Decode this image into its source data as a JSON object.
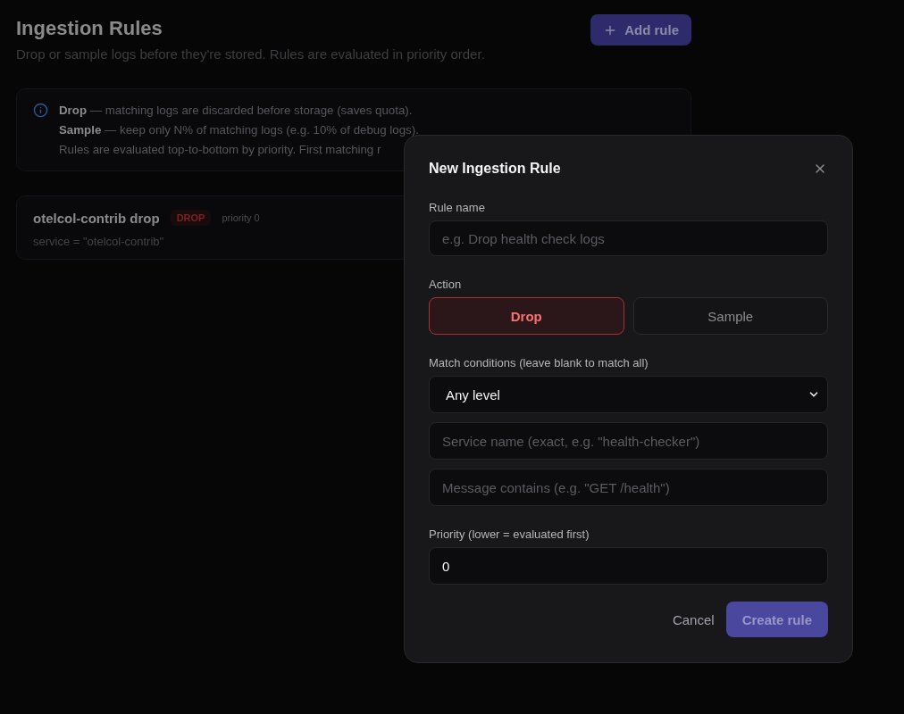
{
  "page": {
    "title": "Ingestion Rules",
    "subtitle": "Drop or sample logs before they're stored. Rules are evaluated in priority order.",
    "add_button": "Add rule"
  },
  "info_box": {
    "lines": [
      "**Drop** — matching logs are discarded before storage (saves quota).",
      "**Sample** — keep only N% of matching logs (e.g. 10% of debug logs).",
      "Rules are evaluated top-to-bottom by priority. First matching r"
    ]
  },
  "rules": [
    {
      "name": "otelcol-contrib drop",
      "action": "DROP",
      "priority": "priority 0",
      "condition": "service = \"otelcol-contrib\""
    }
  ],
  "dialog": {
    "title": "New Ingestion Rule",
    "rule_name": {
      "label": "Rule name",
      "placeholder": "e.g. Drop health check logs"
    },
    "action": {
      "label": "Action",
      "options": [
        {
          "label": "Drop",
          "selected": true
        },
        {
          "label": "Sample",
          "selected": false
        }
      ]
    },
    "match": {
      "label": "Match conditions (leave blank to match all)",
      "level_select": {
        "value": "Any level"
      },
      "service_field": {
        "placeholder": "Service name (exact, e.g. \"health-checker\")"
      },
      "message_field": {
        "placeholder": "Message contains (e.g. \"GET /health\")"
      }
    },
    "priority": {
      "label": "Priority (lower = evaluated first)",
      "value": "0"
    },
    "buttons": {
      "cancel": "Cancel",
      "create": {
        "label": "Create rule",
        "disabled": true
      }
    }
  }
}
